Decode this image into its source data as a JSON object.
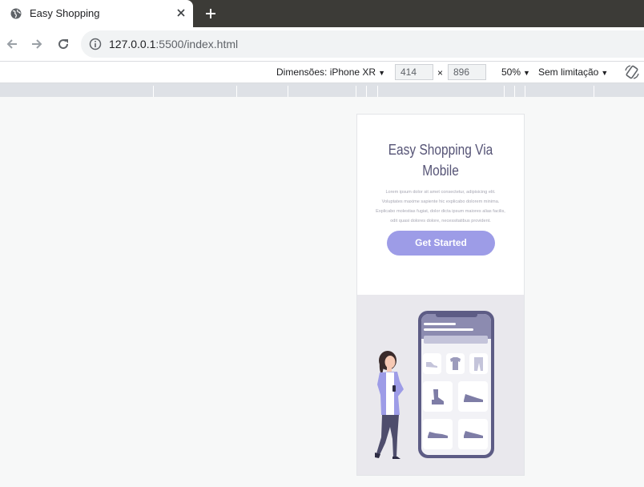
{
  "browser": {
    "tab_title": "Easy Shopping",
    "url_host": "127.0.0.1",
    "url_path": ":5500/index.html"
  },
  "device_toolbar": {
    "dimensions_label": "Dimensões: iPhone XR",
    "width": "414",
    "height": "896",
    "times": "×",
    "zoom": "50%",
    "throttling": "Sem limitação"
  },
  "page": {
    "hero_title_line1": "Easy Shopping Via",
    "hero_title_line2": "Mobile",
    "hero_text_lines": [
      "Lorem ipsum dolor sit amet consectetur, adipisicing elit.",
      "Voluptates maxime sapiente hic explicabo dolorem minima.",
      "Explicabo molestias fugiat, dolor dicta ipsum maiores alias facilis,",
      "odit quasi dolores dolore, necessitatibus provident."
    ],
    "cta_label": "Get Started"
  },
  "colors": {
    "accent": "#9d9ce7",
    "title": "#565476",
    "phone_frame": "#5d5c85",
    "illus_bg": "#e9e8ed"
  },
  "icons": [
    "globe-icon",
    "close-icon",
    "plus-icon",
    "back-icon",
    "forward-icon",
    "reload-icon",
    "info-icon",
    "rotate-icon"
  ]
}
